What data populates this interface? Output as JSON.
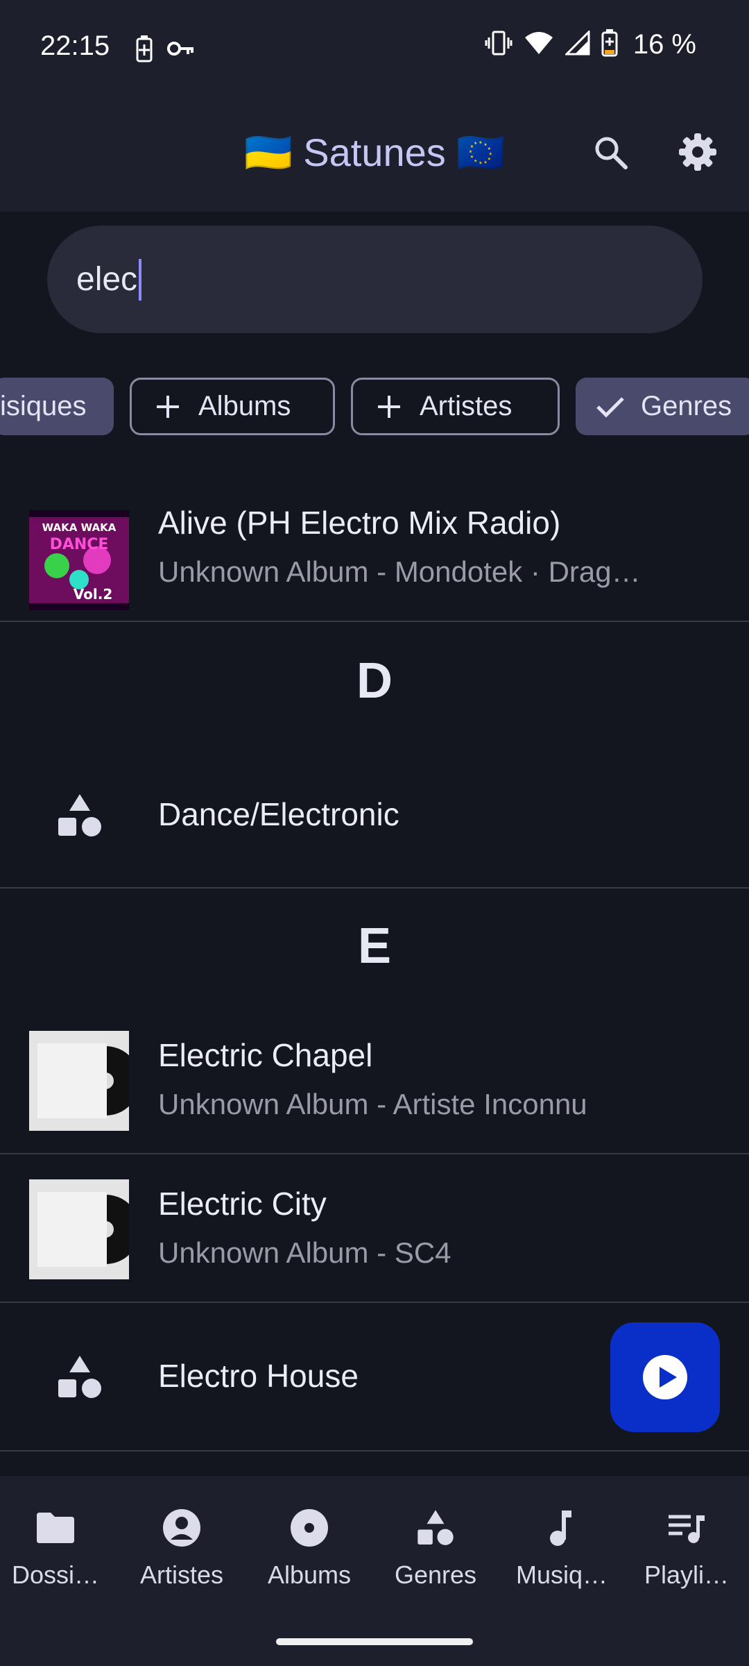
{
  "status_bar": {
    "time": "22:15",
    "battery": "16 %",
    "icons": [
      "battery-saver-icon",
      "vpn-key-icon",
      "vibrate-icon",
      "wifi-icon",
      "signal-icon",
      "battery-icon"
    ]
  },
  "app_bar": {
    "title": "🇺🇦 Satunes 🇪🇺",
    "actions": [
      "search-icon",
      "settings-gear-icon"
    ]
  },
  "search": {
    "value": "elec",
    "placeholder": ""
  },
  "filter_chips": [
    {
      "label": "Musiques",
      "visible_label": "isiques",
      "state": "selected"
    },
    {
      "label": "Albums",
      "state": "unselected"
    },
    {
      "label": "Artistes",
      "state": "unselected"
    },
    {
      "label": "Genres",
      "state": "selected"
    }
  ],
  "results": {
    "items": [
      {
        "type": "song",
        "title": "Alive (PH Electro Mix Radio)",
        "subtitle": "Unknown Album - Mondotek · Drag…",
        "art": "waka-waka-dance-cover"
      },
      {
        "type": "header",
        "letter": "D"
      },
      {
        "type": "genre",
        "title": "Dance/Electronic"
      },
      {
        "type": "header",
        "letter": "E"
      },
      {
        "type": "song",
        "title": "Electric Chapel",
        "subtitle": "Unknown Album - Artiste Inconnu",
        "art": "vinyl-placeholder"
      },
      {
        "type": "song",
        "title": "Electric City",
        "subtitle": "Unknown Album - SC4",
        "art": "vinyl-placeholder"
      },
      {
        "type": "genre",
        "title": "Electro House"
      }
    ],
    "cover_text": {
      "line1": "WAKA WAKA",
      "line2": "DANCE",
      "line3": "Vol.2"
    }
  },
  "fab": {
    "icon": "play-circle-icon"
  },
  "bottom_nav": {
    "items": [
      {
        "label": "Dossi…",
        "icon": "folder-icon"
      },
      {
        "label": "Artistes",
        "icon": "account-circle-icon"
      },
      {
        "label": "Albums",
        "icon": "album-icon"
      },
      {
        "label": "Genres",
        "icon": "category-icon"
      },
      {
        "label": "Musiq…",
        "icon": "music-note-icon"
      },
      {
        "label": "Playli…",
        "icon": "queue-music-icon"
      }
    ]
  },
  "colors": {
    "background": "#13151f",
    "surface": "#1e1f2c",
    "accent": "#c6c6f5",
    "fab": "#0a2fc8"
  }
}
